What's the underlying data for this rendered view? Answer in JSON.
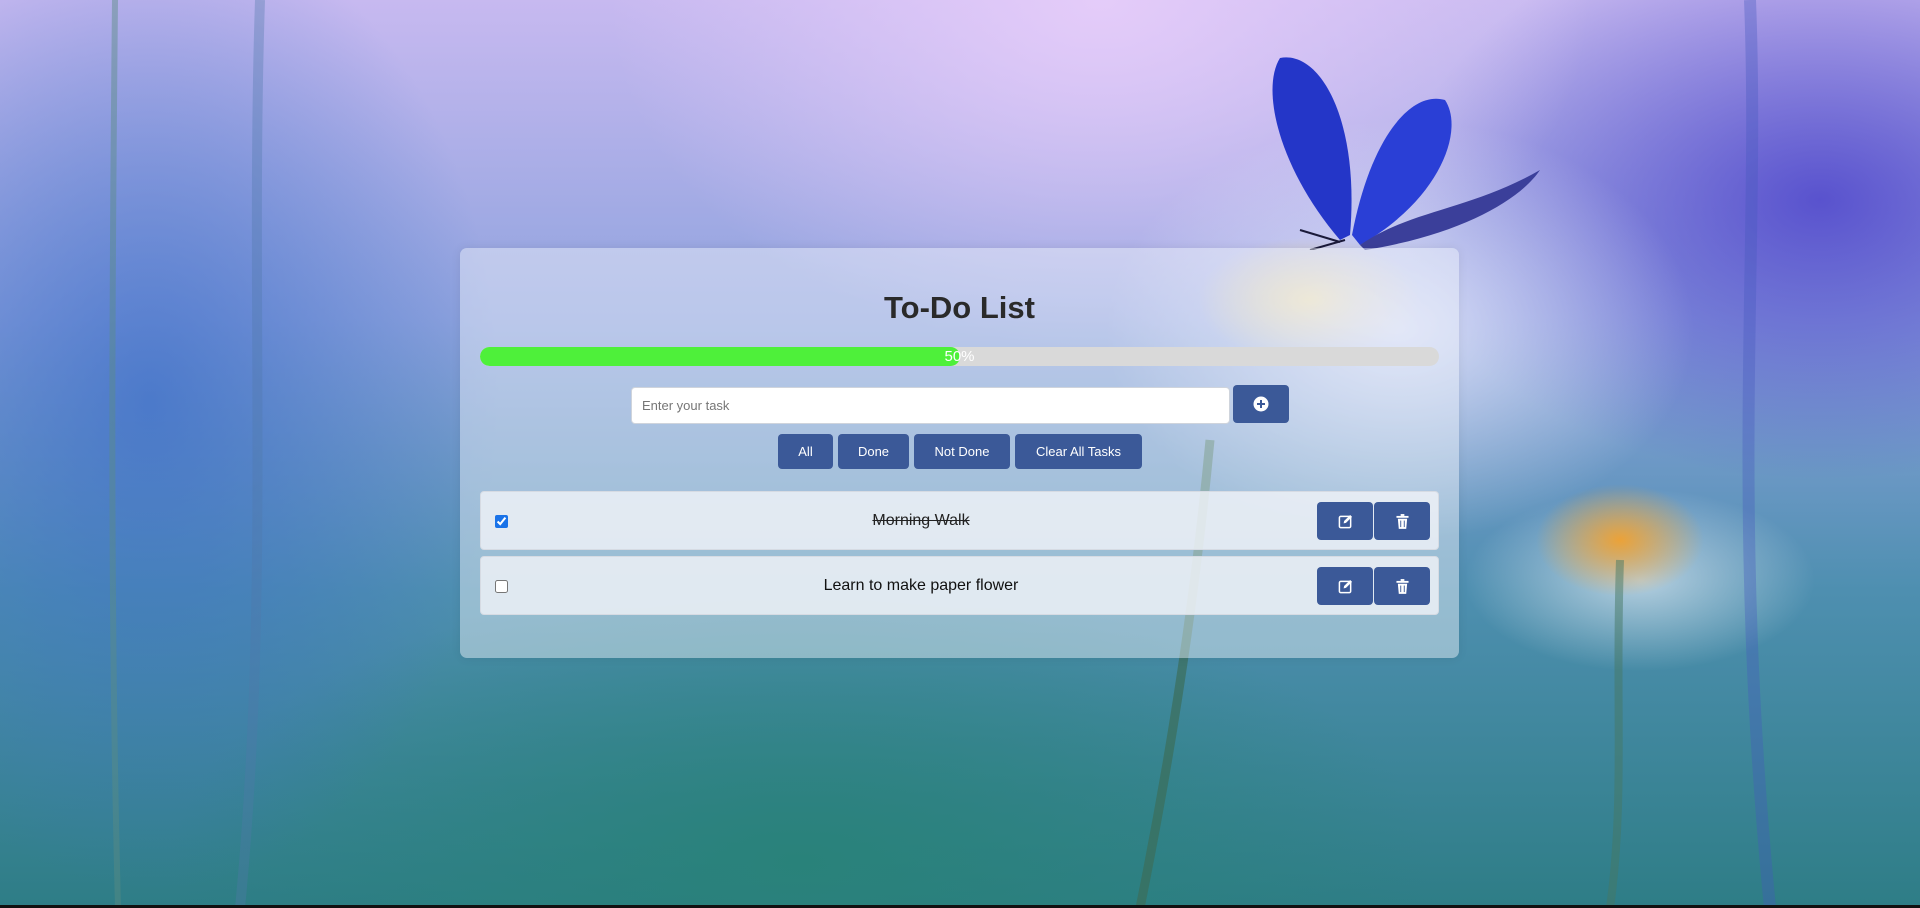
{
  "app": {
    "title": "To-Do List"
  },
  "progress": {
    "percent": 50,
    "label": "50%",
    "fill_color": "#4ef03a",
    "track_color": "#d9d9d9"
  },
  "input": {
    "placeholder": "Enter your task",
    "value": "",
    "add_icon": "plus-circle-icon"
  },
  "filters": [
    {
      "label": "All"
    },
    {
      "label": "Done"
    },
    {
      "label": "Not Done"
    },
    {
      "label": "Clear All Tasks"
    }
  ],
  "tasks": [
    {
      "text": "Morning Walk",
      "done": true
    },
    {
      "text": "Learn to make paper flower",
      "done": false
    }
  ],
  "icons": {
    "edit": "edit-icon",
    "delete": "trash-icon"
  },
  "colors": {
    "button": "#3b5998",
    "button_text": "#ffffff"
  },
  "background": {
    "description_icon": "butterfly-on-daisy-wallpaper"
  }
}
